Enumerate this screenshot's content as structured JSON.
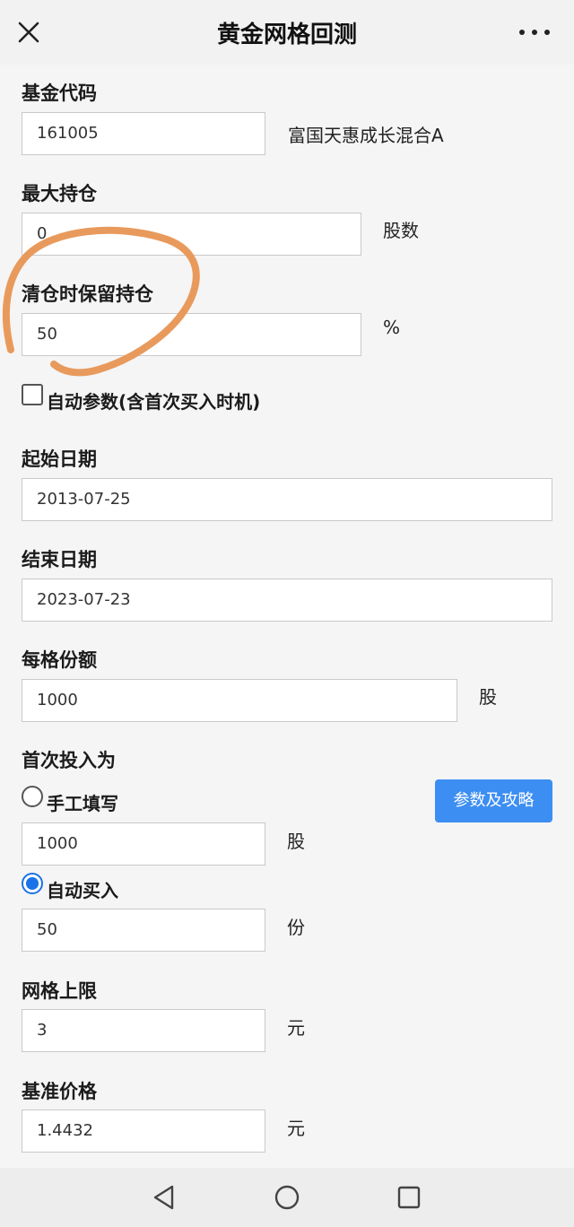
{
  "header": {
    "title": "黄金网格回测",
    "close_icon": "close-icon",
    "more_icon": "more-icon"
  },
  "fund_code": {
    "label": "基金代码",
    "value": "161005",
    "fund_name": "富国天惠成长混合A"
  },
  "max_position": {
    "label": "最大持仓",
    "value": "0",
    "unit": "股数"
  },
  "retain_position": {
    "label": "清仓时保留持仓",
    "value": "50",
    "unit": "%"
  },
  "auto_params": {
    "label": "自动参数(含首次买入时机)",
    "checked": false
  },
  "start_date": {
    "label": "起始日期",
    "value": "2013-07-25"
  },
  "end_date": {
    "label": "结束日期",
    "value": "2023-07-23"
  },
  "per_grid": {
    "label": "每格份额",
    "value": "1000",
    "unit": "股"
  },
  "first_investment": {
    "label": "首次投入为",
    "manual": {
      "label": "手工填写",
      "value": "1000",
      "unit": "股",
      "selected": false
    },
    "auto_buy": {
      "label": "自动买入",
      "value": "50",
      "unit": "份",
      "selected": true
    },
    "guide_button": "参数及攻略"
  },
  "grid_upper": {
    "label": "网格上限",
    "value": "3",
    "unit": "元"
  },
  "base_price": {
    "label": "基准价格",
    "value": "1.4432",
    "unit": "元"
  },
  "annotation_color": "#e89a5c",
  "accent_color": "#3d8ef2",
  "nav": {
    "back_icon": "back-triangle-icon",
    "home_icon": "home-circle-icon",
    "recent_icon": "recents-square-icon"
  }
}
